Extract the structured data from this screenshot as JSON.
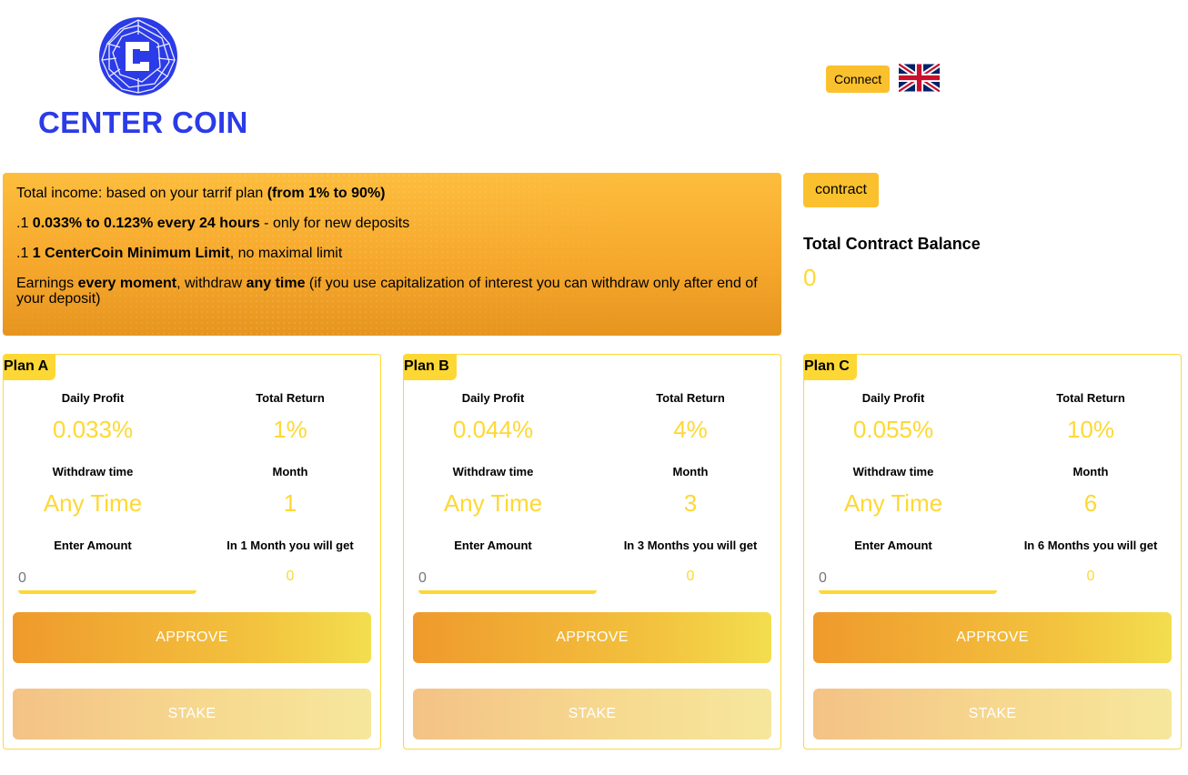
{
  "header": {
    "logo_text": "CENTER COIN",
    "logo_icon": "centercoin-logo-icon",
    "connect_label": "Connect",
    "language_flag": "uk-flag-icon"
  },
  "info": {
    "line1_prefix": "Total income: based on your tarrif plan ",
    "line1_bold": "(from 1% to 90%)",
    "line2_prefix": ".1 ",
    "line2_bold": "0.033% to 0.123% every 24 hours",
    "line2_suffix": " - only for new deposits",
    "line3_prefix": ".1 ",
    "line3_bold": "1 CenterCoin Minimum Limit",
    "line3_suffix": ", no maximal limit",
    "line4_a": "Earnings ",
    "line4_b": "every moment",
    "line4_c": ", withdraw ",
    "line4_d": "any time",
    "line4_e": " (if you use capitalization of interest you can withdraw only after end of your deposit)"
  },
  "contract": {
    "button_label": "contract",
    "balance_label": "Total Contract Balance",
    "balance_value": "0"
  },
  "plans": [
    {
      "name": "Plan A",
      "daily_profit_label": "Daily Profit",
      "daily_profit": "0.033%",
      "total_return_label": "Total Return",
      "total_return": "1%",
      "withdraw_label": "Withdraw time",
      "withdraw_value": "Any Time",
      "month_label": "Month",
      "month_value": "1",
      "amount_label": "Enter Amount",
      "amount_placeholder": "0",
      "get_label": "In 1 Month you will get",
      "get_value": "0",
      "approve_label": "APPROVE",
      "stake_label": "STAKE"
    },
    {
      "name": "Plan B",
      "daily_profit_label": "Daily Profit",
      "daily_profit": "0.044%",
      "total_return_label": "Total Return",
      "total_return": "4%",
      "withdraw_label": "Withdraw time",
      "withdraw_value": "Any Time",
      "month_label": "Month",
      "month_value": "3",
      "amount_label": "Enter Amount",
      "amount_placeholder": "0",
      "get_label": "In 3 Months you will get",
      "get_value": "0",
      "approve_label": "APPROVE",
      "stake_label": "STAKE"
    },
    {
      "name": "Plan C",
      "daily_profit_label": "Daily Profit",
      "daily_profit": "0.055%",
      "total_return_label": "Total Return",
      "total_return": "10%",
      "withdraw_label": "Withdraw time",
      "withdraw_value": "Any Time",
      "month_label": "Month",
      "month_value": "6",
      "amount_label": "Enter Amount",
      "amount_placeholder": "0",
      "get_label": "In 6 Months you will get",
      "get_value": "0",
      "approve_label": "APPROVE",
      "stake_label": "STAKE"
    }
  ],
  "colors": {
    "brand_blue": "#2b3be8",
    "accent_yellow": "#fdd835",
    "button_yellow": "#fbc02d",
    "info_orange": "#f6a82c"
  }
}
